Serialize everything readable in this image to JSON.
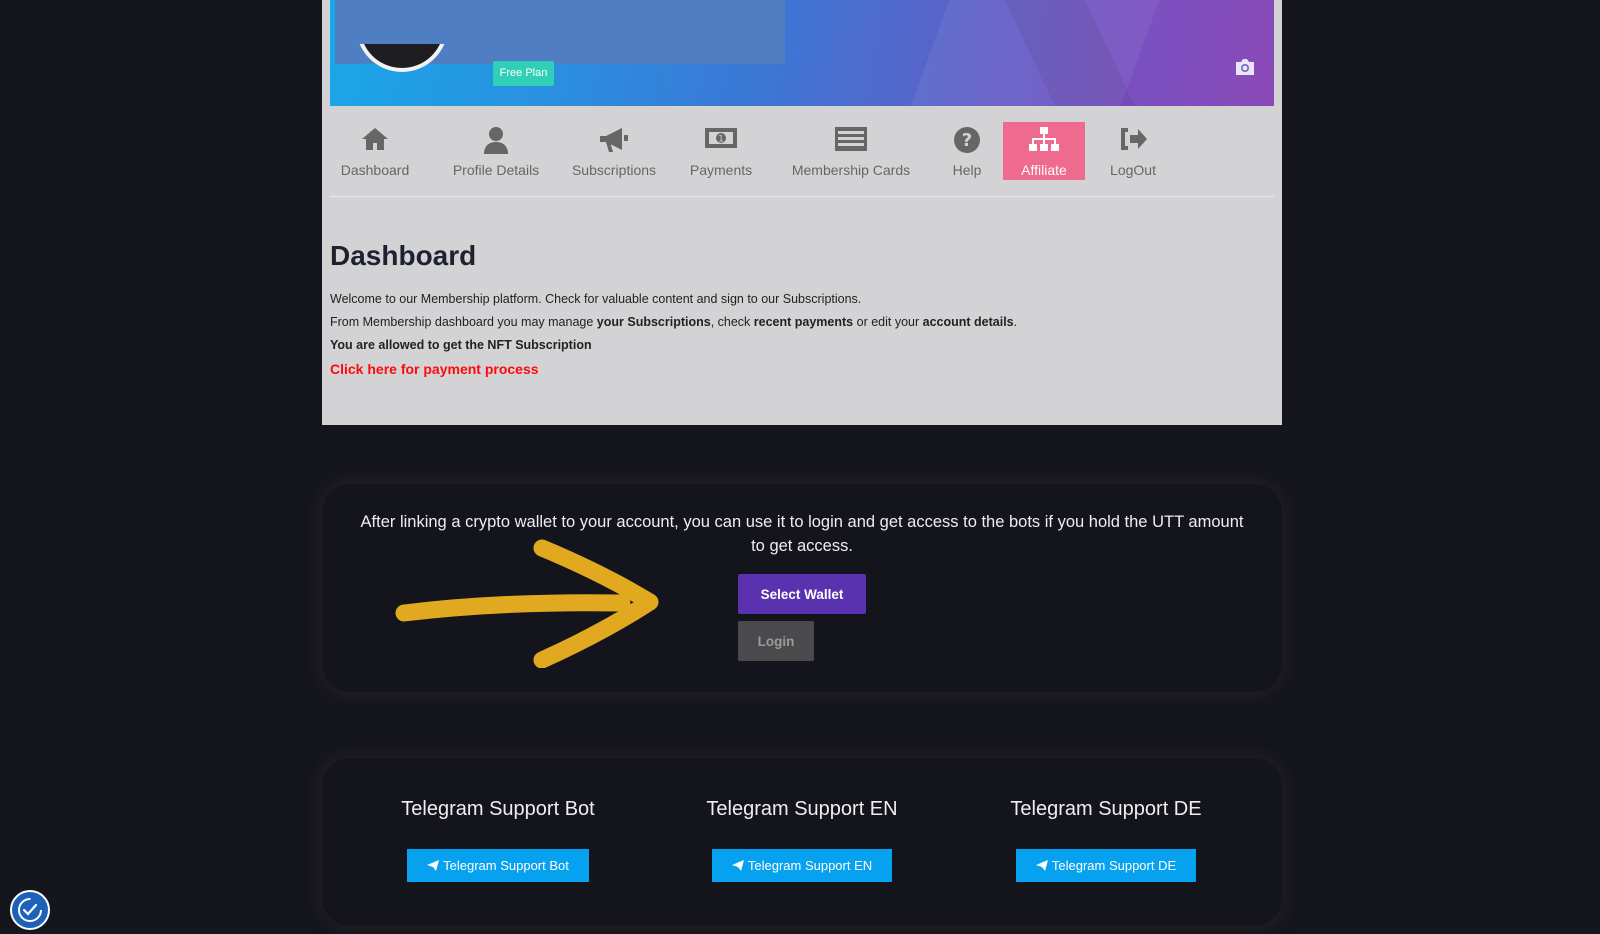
{
  "profile": {
    "plan_badge": "Free Plan"
  },
  "nav": {
    "tabs": [
      {
        "label": "Dashboard",
        "icon": "home-icon"
      },
      {
        "label": "Profile Details",
        "icon": "user-icon"
      },
      {
        "label": "Subscriptions",
        "icon": "megaphone-icon"
      },
      {
        "label": "Payments",
        "icon": "money-icon"
      },
      {
        "label": "Membership Cards",
        "icon": "list-card-icon"
      },
      {
        "label": "Help",
        "icon": "question-icon"
      },
      {
        "label": "Affiliate",
        "icon": "sitemap-icon",
        "active": true
      },
      {
        "label": "LogOut",
        "icon": "logout-icon"
      }
    ]
  },
  "dashboard": {
    "title": "Dashboard",
    "line1": "Welcome to our Membership platform. Check for valuable content and sign to our Subscriptions.",
    "line2_a": "From Membership dashboard you may manage ",
    "line2_b": "your Subscriptions",
    "line2_c": ", check ",
    "line2_d": "recent payments",
    "line2_e": " or edit your ",
    "line2_f": "account details",
    "line2_g": ".",
    "nft_notice": "You are allowed to get the NFT Subscription",
    "payment_link": "Click here for payment process"
  },
  "wallet": {
    "text": "After linking a crypto wallet to your account, you can use it to login and get access to the bots if you hold the UTT amount to get access.",
    "select_label": "Select Wallet",
    "login_label": "Login"
  },
  "support": [
    {
      "title": "Telegram Support Bot",
      "button": "Telegram Support Bot"
    },
    {
      "title": "Telegram Support EN",
      "button": "Telegram Support EN"
    },
    {
      "title": "Telegram Support DE",
      "button": "Telegram Support DE"
    }
  ],
  "colors": {
    "active_tab": "#ee6a8e",
    "select_wallet": "#5a32b0",
    "telegram_button": "#06a2f0",
    "payment_link": "#ff0a0a",
    "arrow": "#e1a91f"
  }
}
